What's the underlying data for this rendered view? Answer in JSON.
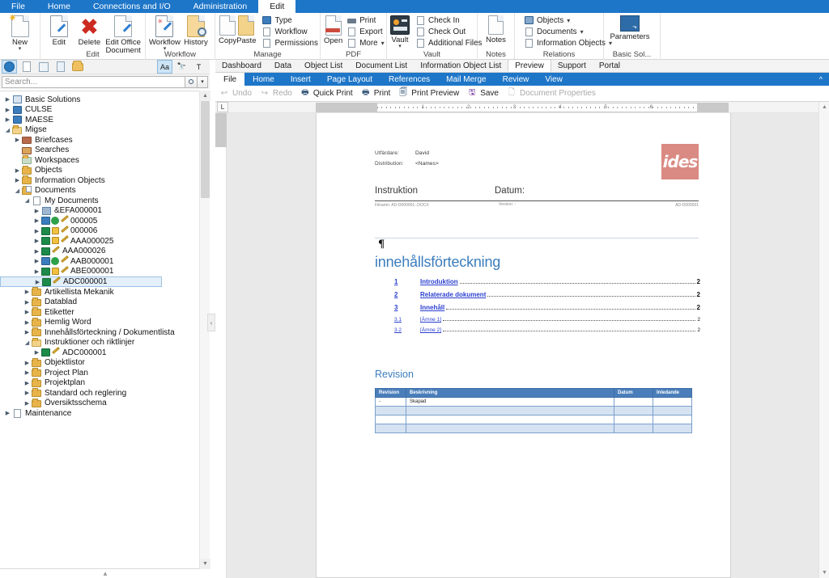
{
  "menubar": {
    "items": [
      {
        "label": "File",
        "active": false
      },
      {
        "label": "Home",
        "active": false
      },
      {
        "label": "Connections and I/O",
        "active": false
      },
      {
        "label": "Administration",
        "active": false
      },
      {
        "label": "Edit",
        "active": true
      }
    ]
  },
  "ribbon": {
    "groups": [
      {
        "label": "",
        "big": [
          {
            "label": "New",
            "icon": "new-document-icon",
            "caret": true
          }
        ]
      },
      {
        "label": "Edit",
        "big": [
          {
            "label": "Edit",
            "icon": "edit-document-icon",
            "caret": false
          },
          {
            "label": "Delete",
            "icon": "delete-icon",
            "caret": false
          },
          {
            "label": "Edit Office Document",
            "icon": "edit-office-document-icon",
            "caret": false
          }
        ]
      },
      {
        "label": "Workflow",
        "big": [
          {
            "label": "Workflow",
            "icon": "workflow-icon",
            "caret": true
          },
          {
            "label": "History",
            "icon": "history-icon",
            "caret": false
          }
        ]
      },
      {
        "label": "Manage",
        "big": [
          {
            "label": "Copy",
            "icon": "copy-icon",
            "caret": false
          },
          {
            "label": "Paste",
            "icon": "paste-icon",
            "caret": false
          }
        ],
        "small": [
          {
            "label": "Type",
            "icon": "type-icon",
            "caret": false
          },
          {
            "label": "Workflow",
            "icon": "workflow-small-icon",
            "caret": false
          },
          {
            "label": "Permissions",
            "icon": "permissions-icon",
            "caret": false
          }
        ]
      },
      {
        "label": "PDF",
        "big": [
          {
            "label": "Open",
            "icon": "open-pdf-icon",
            "caret": false
          }
        ],
        "small": [
          {
            "label": "Print",
            "icon": "print-icon",
            "caret": false
          },
          {
            "label": "Export",
            "icon": "export-icon",
            "caret": false
          },
          {
            "label": "More",
            "icon": "more-icon",
            "caret": true
          }
        ]
      },
      {
        "label": "Vault",
        "big": [
          {
            "label": "Vault",
            "icon": "vault-icon",
            "caret": true
          }
        ],
        "small": [
          {
            "label": "Check In",
            "icon": "check-in-icon",
            "caret": false
          },
          {
            "label": "Check Out",
            "icon": "check-out-icon",
            "caret": false
          },
          {
            "label": "Additional Files",
            "icon": "additional-files-icon",
            "caret": false
          }
        ]
      },
      {
        "label": "Notes",
        "big": [
          {
            "label": "Notes",
            "icon": "notes-icon",
            "caret": false
          }
        ]
      },
      {
        "label": "Relations",
        "small": [
          {
            "label": "Objects",
            "icon": "objects-icon",
            "caret": true
          },
          {
            "label": "Documents",
            "icon": "documents-icon",
            "caret": true
          },
          {
            "label": "Information Objects",
            "icon": "information-objects-icon",
            "caret": true
          }
        ]
      },
      {
        "label": "Basic Sol...",
        "big": [
          {
            "label": "Parameters",
            "icon": "parameters-icon",
            "caret": false
          }
        ]
      }
    ]
  },
  "left_toolbar": {
    "buttons": [
      {
        "name": "globe-icon",
        "selected": true
      },
      {
        "name": "new-file-icon",
        "selected": false
      },
      {
        "name": "preview-file-icon",
        "selected": false
      },
      {
        "name": "copy-file-icon",
        "selected": false
      },
      {
        "name": "folder-icon",
        "selected": false
      }
    ],
    "right_buttons": [
      {
        "name": "match-case-icon",
        "label": "Aa",
        "selected": true
      },
      {
        "name": "find-icon",
        "label": "",
        "selected": false
      },
      {
        "name": "filter-text-icon",
        "label": "",
        "selected": false
      }
    ]
  },
  "search": {
    "placeholder": "Search...",
    "value": ""
  },
  "tree": {
    "nodes": [
      {
        "label": "Basic Solutions",
        "indent": 0,
        "expander": "collapsed",
        "icon": "solutions-icon",
        "selected": false
      },
      {
        "label": "CULSE",
        "indent": 0,
        "expander": "collapsed",
        "icon": "folder-blue-icon",
        "selected": false
      },
      {
        "label": "MAESE",
        "indent": 0,
        "expander": "collapsed",
        "icon": "folder-blue-icon",
        "selected": false
      },
      {
        "label": "Migse",
        "indent": 0,
        "expander": "expanded",
        "icon": "folder-open-icon",
        "selected": false
      },
      {
        "label": "Briefcases",
        "indent": 1,
        "expander": "collapsed",
        "icon": "briefcase-icon",
        "selected": false
      },
      {
        "label": "Searches",
        "indent": 1,
        "expander": "none",
        "icon": "search-folder-icon",
        "selected": false
      },
      {
        "label": "Workspaces",
        "indent": 1,
        "expander": "none",
        "icon": "workspace-icon",
        "selected": false
      },
      {
        "label": "Objects",
        "indent": 1,
        "expander": "collapsed",
        "icon": "folder-icon",
        "selected": false
      },
      {
        "label": "Information Objects",
        "indent": 1,
        "expander": "collapsed",
        "icon": "folder-icon",
        "selected": false
      },
      {
        "label": "Documents",
        "indent": 1,
        "expander": "expanded",
        "icon": "documents-folder-icon",
        "selected": false
      },
      {
        "label": "My Documents",
        "indent": 2,
        "expander": "expanded",
        "icon": "my-documents-icon",
        "selected": false
      },
      {
        "label": "&EFA000001",
        "indent": 3,
        "expander": "collapsed",
        "icon": "doc-grid-icon",
        "selected": false
      },
      {
        "label": "000005",
        "indent": 3,
        "expander": "collapsed",
        "icon": "doc-checked-out-icon",
        "selected": false
      },
      {
        "label": "000006",
        "indent": 3,
        "expander": "collapsed",
        "icon": "doc-locked-icon",
        "selected": false
      },
      {
        "label": "AAA000025",
        "indent": 3,
        "expander": "collapsed",
        "icon": "doc-locked-icon",
        "selected": false
      },
      {
        "label": "AAA000026",
        "indent": 3,
        "expander": "collapsed",
        "icon": "doc-edit-icon",
        "selected": false
      },
      {
        "label": "AAB000001",
        "indent": 3,
        "expander": "collapsed",
        "icon": "doc-checked-out-icon",
        "selected": false
      },
      {
        "label": "ABE000001",
        "indent": 3,
        "expander": "collapsed",
        "icon": "doc-locked-icon",
        "selected": false
      },
      {
        "label": "ADC000001",
        "indent": 3,
        "expander": "collapsed",
        "icon": "doc-edit-icon",
        "selected": true
      },
      {
        "label": "Artikellista Mekanik",
        "indent": 2,
        "expander": "collapsed",
        "icon": "folder-icon",
        "selected": false
      },
      {
        "label": "Datablad",
        "indent": 2,
        "expander": "collapsed",
        "icon": "folder-icon",
        "selected": false
      },
      {
        "label": "Etiketter",
        "indent": 2,
        "expander": "collapsed",
        "icon": "folder-icon",
        "selected": false
      },
      {
        "label": "Hemlig Word",
        "indent": 2,
        "expander": "collapsed",
        "icon": "folder-icon",
        "selected": false
      },
      {
        "label": "Innehållsförteckning / Dokumentlista",
        "indent": 2,
        "expander": "collapsed",
        "icon": "folder-icon",
        "selected": false
      },
      {
        "label": "Instruktioner och riktlinjer",
        "indent": 2,
        "expander": "expanded",
        "icon": "folder-open-icon",
        "selected": false
      },
      {
        "label": "ADC000001",
        "indent": 3,
        "expander": "collapsed",
        "icon": "doc-edit-icon",
        "selected": false
      },
      {
        "label": "Objektlistor",
        "indent": 2,
        "expander": "collapsed",
        "icon": "folder-icon",
        "selected": false
      },
      {
        "label": "Project Plan",
        "indent": 2,
        "expander": "collapsed",
        "icon": "folder-icon",
        "selected": false
      },
      {
        "label": "Projektplan",
        "indent": 2,
        "expander": "collapsed",
        "icon": "folder-icon",
        "selected": false
      },
      {
        "label": "Standard och reglering",
        "indent": 2,
        "expander": "collapsed",
        "icon": "folder-icon",
        "selected": false
      },
      {
        "label": "Översiktsschema",
        "indent": 2,
        "expander": "collapsed",
        "icon": "folder-icon",
        "selected": false
      },
      {
        "label": "Maintenance",
        "indent": 0,
        "expander": "collapsed",
        "icon": "maintenance-icon",
        "selected": false
      }
    ]
  },
  "module_tabs": [
    {
      "label": "Dashboard",
      "active": false
    },
    {
      "label": "Data",
      "active": false
    },
    {
      "label": "Object List",
      "active": false
    },
    {
      "label": "Document List",
      "active": false
    },
    {
      "label": "Information Object List",
      "active": false
    },
    {
      "label": "Preview",
      "active": true
    },
    {
      "label": "Support",
      "active": false
    },
    {
      "label": "Portal",
      "active": false
    }
  ],
  "word_tabs": [
    {
      "label": "File",
      "active": true
    },
    {
      "label": "Home",
      "active": false
    },
    {
      "label": "Insert",
      "active": false
    },
    {
      "label": "Page Layout",
      "active": false
    },
    {
      "label": "References",
      "active": false
    },
    {
      "label": "Mail Merge",
      "active": false
    },
    {
      "label": "Review",
      "active": false
    },
    {
      "label": "View",
      "active": false
    }
  ],
  "word_ribbon": [
    {
      "label": "Undo",
      "icon": "undo-icon",
      "disabled": true
    },
    {
      "label": "Redo",
      "icon": "redo-icon",
      "disabled": true
    },
    {
      "label": "Quick Print",
      "icon": "quick-print-icon",
      "disabled": false
    },
    {
      "label": "Print",
      "icon": "print-icon",
      "disabled": false
    },
    {
      "label": "Print Preview",
      "icon": "print-preview-icon",
      "disabled": false
    },
    {
      "label": "Save",
      "icon": "save-icon",
      "disabled": false
    },
    {
      "label": "Document Properties",
      "icon": "document-properties-icon",
      "disabled": true
    }
  ],
  "ruler": {
    "tab_stop_symbol": "L",
    "ticks": [
      "1",
      "2",
      "3",
      "4",
      "5",
      "6"
    ]
  },
  "document": {
    "header": {
      "rows": [
        {
          "key": "Utfärdare:",
          "value": "David"
        },
        {
          "key": "Distribution:",
          "value": "<Names>"
        }
      ],
      "version_label": "Version: -",
      "logo_text": "ides",
      "title_left": "Instruktion",
      "title_right": "Datum:",
      "filename_label": "Filnamn: AD-D000001-.DOCX",
      "doc_id": "AD-D000001"
    },
    "body_mark": "¶",
    "toc": {
      "heading": "innehållsförteckning",
      "entries": [
        {
          "num": "1",
          "title": "Introduktion",
          "page": "2",
          "sub": false
        },
        {
          "num": "2",
          "title": "Relaterade dokument",
          "page": "2",
          "sub": false
        },
        {
          "num": "3",
          "title": "Innehåll",
          "page": "2",
          "sub": false
        },
        {
          "num": "3.1",
          "title": "[Ämne 1]",
          "page": "2",
          "sub": true
        },
        {
          "num": "3.2",
          "title": "[Ämne 2]",
          "page": "2",
          "sub": true
        }
      ]
    },
    "revision": {
      "heading": "Revision",
      "columns": [
        "Revision",
        "Beskrivning",
        "Datum",
        "Inledande"
      ],
      "rows": [
        [
          "-",
          "Skapad",
          "",
          ""
        ],
        [
          "",
          "",
          "",
          ""
        ],
        [
          "",
          "",
          "",
          ""
        ],
        [
          "",
          "",
          "",
          ""
        ]
      ]
    }
  },
  "colors": {
    "brand_blue": "#1e76c8",
    "accent_blue": "#3b7dbd",
    "logo_red": "#d98a82",
    "link_blue": "#2a3fd0",
    "selection": "#e3eff9"
  }
}
